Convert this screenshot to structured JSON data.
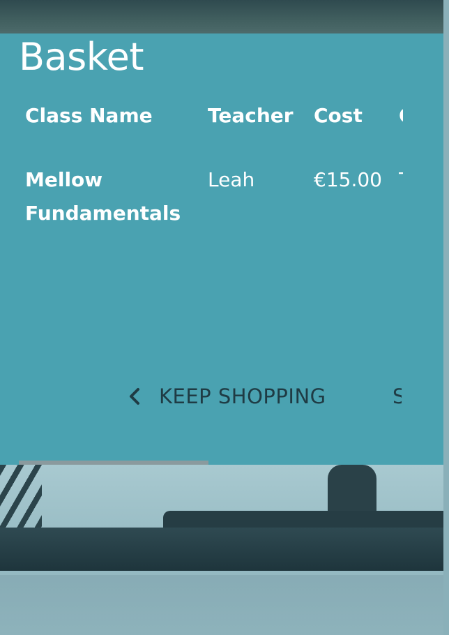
{
  "basket": {
    "title": "Basket",
    "columns": [
      "Class Name",
      "Teacher",
      "Cost",
      "C"
    ],
    "rows": [
      {
        "class_name": "Mellow Fundamentals",
        "teacher": "Leah",
        "cost": "€15.00",
        "extra": "T"
      }
    ]
  },
  "actions": {
    "keep_shopping_label": "KEEP SHOPPING",
    "next_label": "S"
  },
  "icons": {
    "back": "chevron-left-icon"
  },
  "colors": {
    "panel_background": "#4aa2b1",
    "panel_text": "#ffffff",
    "action_text": "#1f3b44",
    "scrollbar_thumb": "#8a9a9e"
  }
}
